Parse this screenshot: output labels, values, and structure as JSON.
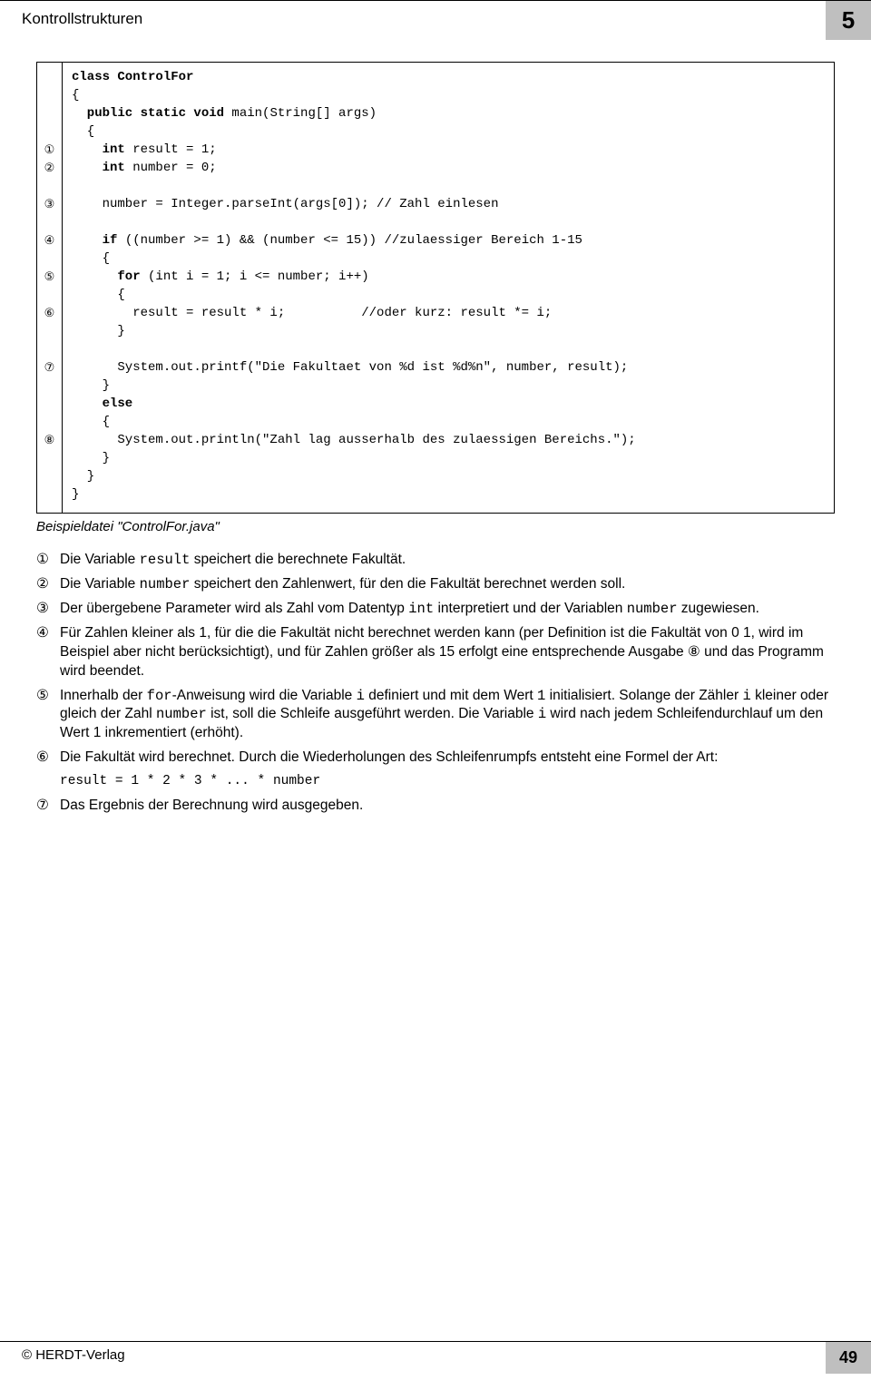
{
  "header": {
    "title": "Kontrollstrukturen",
    "chapter": "5"
  },
  "code": {
    "line01": "class ControlFor",
    "line02": "{",
    "line03a": "  public static void",
    "line03b": " main(String[] args)",
    "line04": "  {",
    "line05a": "    int",
    "line05b": " result = 1;",
    "line06a": "    int",
    "line06b": " number = 0;",
    "line07": "",
    "line08": "    number = Integer.parseInt(args[0]); // Zahl einlesen",
    "line09": "",
    "line10a": "    if",
    "line10b": " ((number >= 1) && (number <= 15)) //zulaessiger Bereich 1-15",
    "line11": "    {",
    "line12a": "      for",
    "line12b": " (int i = 1; i <= number; i++)",
    "line13": "      {",
    "line14": "        result = result * i;          //oder kurz: result *= i;",
    "line15": "      }",
    "line16": "",
    "line17": "      System.out.printf(\"Die Fakultaet von %d ist %d%n\", number, result);",
    "line18": "    }",
    "line19a": "    else",
    "line20": "    {",
    "line21": "      System.out.println(\"Zahl lag ausserhalb des zulaessigen Bereichs.\");",
    "line22": "    }",
    "line23": "  }",
    "line24": "}"
  },
  "markers": {
    "m1": "①",
    "m2": "②",
    "m3": "③",
    "m4": "④",
    "m5": "⑤",
    "m6": "⑥",
    "m7": "⑦",
    "m8": "⑧"
  },
  "caption": "Beispieldatei \"ControlFor.java\"",
  "explain": {
    "n1": "①",
    "t1a": "Die Variable ",
    "t1b": "result",
    "t1c": " speichert die berechnete Fakultät.",
    "n2": "②",
    "t2a": "Die Variable ",
    "t2b": "number",
    "t2c": " speichert den Zahlenwert, für den die Fakultät berechnet werden soll.",
    "n3": "③",
    "t3a": "Der übergebene Parameter wird als Zahl vom Datentyp ",
    "t3b": "int",
    "t3c": " interpretiert und der Variablen ",
    "t3d": "number",
    "t3e": " zugewiesen.",
    "n4": "④",
    "t4": "Für Zahlen kleiner als 1, für die die Fakultät nicht berechnet werden kann (per Definition ist die Fakultät von 0 1, wird im Beispiel aber nicht berücksichtigt), und für Zahlen größer als 15 erfolgt eine entsprechende Ausgabe ⑧ und das Programm wird beendet.",
    "n5": "⑤",
    "t5a": "Innerhalb der ",
    "t5b": "for",
    "t5c": "-Anweisung wird die Variable ",
    "t5d": "i",
    "t5e": " definiert und mit dem Wert ",
    "t5f": "1",
    "t5g": " initialisiert. Solange der Zähler ",
    "t5h": "i",
    "t5i": " kleiner oder gleich der Zahl ",
    "t5j": "number",
    "t5k": " ist, soll die Schleife ausgeführt werden. Die Variable ",
    "t5l": "i",
    "t5m": " wird nach jedem Schleifendurchlauf um den Wert 1 inkrementiert (erhöht).",
    "n6": "⑥",
    "t6": "Die Fakultät wird berechnet. Durch die Wiederholungen des Schleifenrumpfs entsteht eine Formel der Art:",
    "formula": "result = 1 * 2 * 3 * ... * number",
    "n7": "⑦",
    "t7": "Das Ergebnis der Berechnung wird ausgegeben."
  },
  "footer": {
    "publisher": "© HERDT-Verlag",
    "page": "49"
  }
}
